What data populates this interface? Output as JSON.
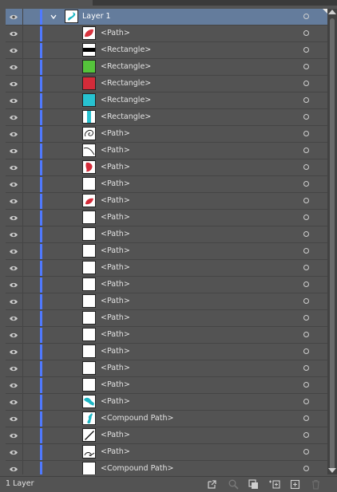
{
  "panel": {
    "layer": {
      "name": "Layer 1",
      "thumb": "layer-thumbnail"
    },
    "items": [
      {
        "name": "<Path>",
        "thumb": "red-leaf"
      },
      {
        "name": "<Rectangle>",
        "thumb": "black-bar"
      },
      {
        "name": "<Rectangle>",
        "thumb": "green-swatch"
      },
      {
        "name": "<Rectangle>",
        "thumb": "red-swatch"
      },
      {
        "name": "<Rectangle>",
        "thumb": "cyan-swatch"
      },
      {
        "name": "<Rectangle>",
        "thumb": "cyan-strip"
      },
      {
        "name": "<Path>",
        "thumb": "swirl"
      },
      {
        "name": "<Path>",
        "thumb": "curve"
      },
      {
        "name": "<Path>",
        "thumb": "red-heart"
      },
      {
        "name": "<Path>",
        "thumb": "blank"
      },
      {
        "name": "<Path>",
        "thumb": "red-leaf-small"
      },
      {
        "name": "<Path>",
        "thumb": "blank"
      },
      {
        "name": "<Path>",
        "thumb": "blank"
      },
      {
        "name": "<Path>",
        "thumb": "blank"
      },
      {
        "name": "<Path>",
        "thumb": "blank"
      },
      {
        "name": "<Path>",
        "thumb": "blank"
      },
      {
        "name": "<Path>",
        "thumb": "blank"
      },
      {
        "name": "<Path>",
        "thumb": "blank"
      },
      {
        "name": "<Path>",
        "thumb": "blank"
      },
      {
        "name": "<Path>",
        "thumb": "blank"
      },
      {
        "name": "<Path>",
        "thumb": "blank"
      },
      {
        "name": "<Path>",
        "thumb": "blank"
      },
      {
        "name": "<Path>",
        "thumb": "cyan-wave"
      },
      {
        "name": "<Compound Path>",
        "thumb": "cyan-figure"
      },
      {
        "name": "<Path>",
        "thumb": "black-stroke"
      },
      {
        "name": "<Path>",
        "thumb": "swirl-line"
      },
      {
        "name": "<Compound Path>",
        "thumb": "blank"
      }
    ]
  },
  "footer": {
    "layer_count": "1 Layer",
    "icons": [
      "export-icon",
      "locate-object-icon",
      "clipping-mask-icon",
      "new-sublayer-icon",
      "new-layer-icon",
      "trash-icon"
    ]
  },
  "colors": {
    "layer_color": "#4f79ff",
    "selected_row": "#647c9c",
    "panel_bg": "#535353"
  }
}
